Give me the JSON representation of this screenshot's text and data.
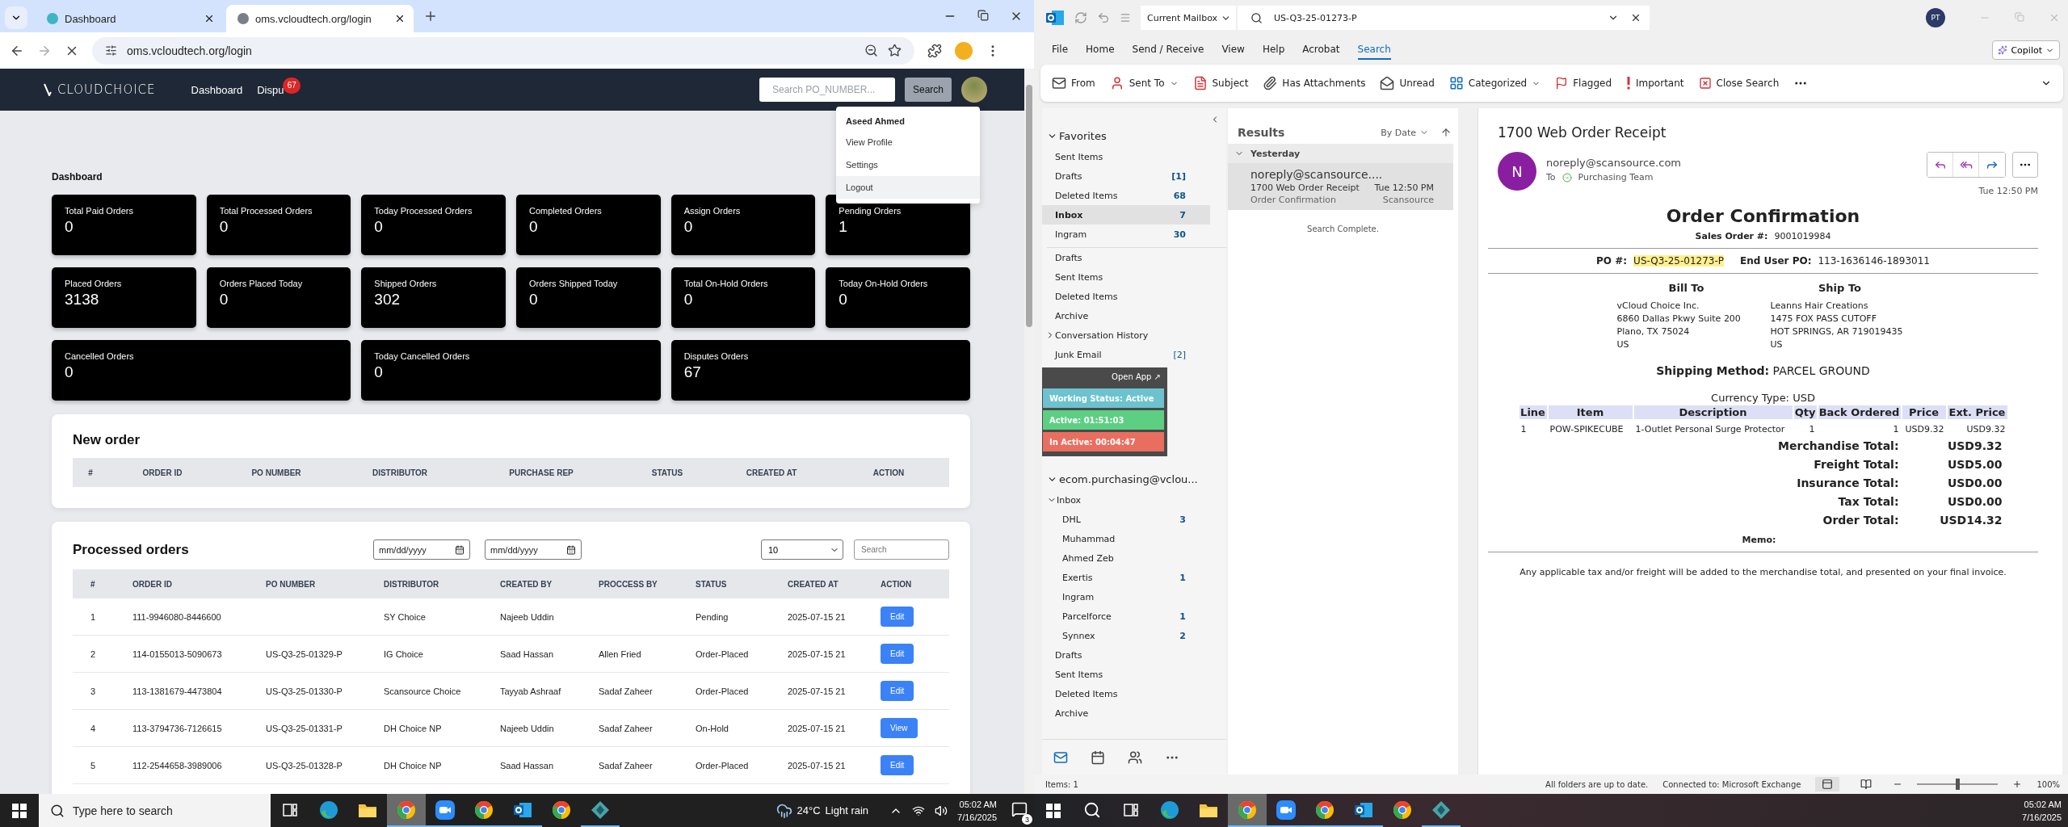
{
  "browser": {
    "tabs": [
      {
        "title": "Dashboard",
        "selected": false
      },
      {
        "title": "oms.vcloudtech.org/login",
        "selected": true
      }
    ],
    "address": "oms.vcloudtech.org/login",
    "nav": {
      "logo": "CLOUDCHOICE",
      "links": [
        {
          "label": "Dashboard"
        },
        {
          "label": "Dispu",
          "badge": "67"
        }
      ],
      "search_placeholder": "Search PO_NUMBER...",
      "search_button": "Search"
    },
    "user_menu": {
      "name": "Aseed Ahmed",
      "items": [
        {
          "label": "View Profile",
          "hovered": false
        },
        {
          "label": "Settings",
          "hovered": false
        },
        {
          "label": "Logout",
          "hovered": true
        }
      ]
    },
    "dashboard": {
      "title": "Dashboard",
      "cards": [
        {
          "label": "Total Paid Orders",
          "value": "0",
          "kind": "normal"
        },
        {
          "label": "Total Processed Orders",
          "value": "0",
          "kind": "normal"
        },
        {
          "label": "Today Processed Orders",
          "value": "0",
          "kind": "normal"
        },
        {
          "label": "Completed Orders",
          "value": "0",
          "kind": "normal"
        },
        {
          "label": "Assign Orders",
          "value": "0",
          "kind": "normal"
        },
        {
          "label": "Pending Orders",
          "value": "1",
          "kind": "normal"
        },
        {
          "label": "Placed Orders",
          "value": "3138",
          "kind": "normal"
        },
        {
          "label": "Orders Placed Today",
          "value": "0",
          "kind": "normal"
        },
        {
          "label": "Shipped Orders",
          "value": "302",
          "kind": "normal"
        },
        {
          "label": "Orders Shipped Today",
          "value": "0",
          "kind": "normal"
        },
        {
          "label": "Total On-Hold Orders",
          "value": "0",
          "kind": "normal"
        },
        {
          "label": "Today On-Hold Orders",
          "value": "0",
          "kind": "normal"
        },
        {
          "label": "Cancelled Orders",
          "value": "0",
          "kind": "wide"
        },
        {
          "label": "Today Cancelled Orders",
          "value": "0",
          "kind": "wide"
        },
        {
          "label": "Disputes Orders",
          "value": "67",
          "kind": "wide"
        }
      ]
    },
    "new_order": {
      "title": "New order",
      "columns": [
        "#",
        "ORDER ID",
        "PO NUMBER",
        "DISTRIBUTOR",
        "PURCHASE REP",
        "STATUS",
        "CREATED AT",
        "ACTION"
      ]
    },
    "processed": {
      "title": "Processed orders",
      "date_from": "mm/dd/yyyy",
      "date_to": "mm/dd/yyyy",
      "page_size": "10",
      "search_placeholder": "Search",
      "columns": [
        "#",
        "ORDER ID",
        "PO NUMBER",
        "DISTRIBUTOR",
        "CREATED BY",
        "PROCCESS BY",
        "STATUS",
        "CREATED AT",
        "ACTION"
      ],
      "rows": [
        {
          "num": "1",
          "order_id": "111-9946080-8446600",
          "distributor": "SY Choice",
          "created_by": "Najeeb Uddin",
          "status": "Pending",
          "created_at": "2025-07-15 21",
          "action": "Edit"
        },
        {
          "num": "2",
          "order_id": "114-0155013-5090673",
          "po_number": "US-Q3-25-01329-P",
          "distributor": "IG Choice",
          "created_by": "Saad Hassan",
          "process_by": "Allen Fried",
          "status": "Order-Placed",
          "created_at": "2025-07-15 21",
          "action": "Edit"
        },
        {
          "num": "3",
          "order_id": "113-1381679-4473804",
          "po_number": "US-Q3-25-01330-P",
          "distributor": "Scansource Choice",
          "created_by": "Tayyab Ashraaf",
          "process_by": "Sadaf Zaheer",
          "status": "Order-Placed",
          "created_at": "2025-07-15 21",
          "action": "Edit"
        },
        {
          "num": "4",
          "order_id": "113-3794736-7126615",
          "po_number": "US-Q3-25-01331-P",
          "distributor": "DH Choice NP",
          "created_by": "Najeeb Uddin",
          "process_by": "Sadaf Zaheer",
          "status": "On-Hold",
          "created_at": "2025-07-15 21",
          "action": "View"
        },
        {
          "num": "5",
          "order_id": "112-2544658-3989006",
          "po_number": "US-Q3-25-01328-P",
          "distributor": "DH Choice NP",
          "created_by": "Saad Hassan",
          "process_by": "Sadaf Zaheer",
          "status": "Order-Placed",
          "created_at": "2025-07-15 21",
          "action": "Edit"
        }
      ]
    }
  },
  "taskbar_left": {
    "search_placeholder": "Type here to search",
    "apps": [
      {
        "kind": "task-view",
        "selected": false,
        "running": false
      },
      {
        "kind": "edge",
        "selected": false,
        "running": false
      },
      {
        "kind": "explorer",
        "selected": false,
        "running": false
      },
      {
        "kind": "chrome",
        "selected": true,
        "running": true
      },
      {
        "kind": "zoom",
        "selected": false,
        "running": true
      },
      {
        "kind": "chrome",
        "selected": false,
        "running": true
      },
      {
        "kind": "outlook",
        "selected": false,
        "running": true
      },
      {
        "kind": "chrome",
        "selected": false,
        "running": false
      },
      {
        "kind": "app",
        "selected": false,
        "running": true
      }
    ],
    "weather": {
      "temp": "24°C",
      "text": "Light rain"
    },
    "time": "05:02 AM",
    "date": "7/16/2025",
    "notifications": "3"
  },
  "outlook": {
    "mailbox_scope": "Current Mailbox",
    "search_query": "US-Q3-25-01273-P",
    "user_initials": "PT",
    "copilot": "Copilot",
    "menu": [
      {
        "label": "File",
        "selected": false
      },
      {
        "label": "Home",
        "selected": false
      },
      {
        "label": "Send / Receive",
        "selected": false
      },
      {
        "label": "View",
        "selected": false
      },
      {
        "label": "Help",
        "selected": false
      },
      {
        "label": "Acrobat",
        "selected": false
      },
      {
        "label": "Search",
        "selected": true
      }
    ],
    "ribbon": [
      {
        "label": "From",
        "kind": "from",
        "dropdown": false
      },
      {
        "label": "Sent To",
        "kind": "sent-to",
        "dropdown": true
      },
      {
        "label": "Subject",
        "kind": "subject",
        "dropdown": false
      },
      {
        "label": "Has Attachments",
        "kind": "attachments",
        "dropdown": false
      },
      {
        "label": "Unread",
        "kind": "unread",
        "dropdown": false
      },
      {
        "label": "Categorized",
        "kind": "categorized",
        "dropdown": true
      },
      {
        "label": "Flagged",
        "kind": "flagged",
        "dropdown": false
      },
      {
        "label": "Important",
        "kind": "important",
        "dropdown": false
      },
      {
        "label": "Close Search",
        "kind": "close-search",
        "dropdown": false
      }
    ],
    "favorites": {
      "label": "Favorites",
      "expanded": true,
      "items": [
        {
          "name": "Sent Items",
          "selected": false
        },
        {
          "name": "Drafts",
          "count": "[1]",
          "selected": false
        },
        {
          "name": "Deleted Items",
          "count": "68",
          "selected": false
        },
        {
          "name": "Inbox",
          "count": "7",
          "selected": true
        },
        {
          "name": "Ingram",
          "count": "30",
          "selected": false
        }
      ]
    },
    "folders": [
      {
        "name": "Drafts"
      },
      {
        "name": "Sent Items"
      },
      {
        "name": "Deleted Items"
      },
      {
        "name": "Archive"
      },
      {
        "name": "Conversation History",
        "expanded": false
      },
      {
        "name": "Junk Email",
        "count": "[2]"
      }
    ],
    "status_widget": {
      "open_app": "Open App ↗",
      "rows": [
        {
          "label": "Working Status: Active",
          "color": "#6cc3cf"
        },
        {
          "label": "Active: 01:51:03",
          "color": "#5ccf83"
        },
        {
          "label": "In Active: 00:04:47",
          "color": "#ea6e5f"
        }
      ]
    },
    "account": {
      "label": "ecom.purchasing@vclou...",
      "expanded": true,
      "folders": [
        {
          "name": "Inbox",
          "expanded": true,
          "children": [
            {
              "name": "DHL",
              "count": "3"
            },
            {
              "name": "Muhammad"
            },
            {
              "name": "Ahmed Zeb"
            },
            {
              "name": "Exertis",
              "count": "1"
            },
            {
              "name": "Ingram"
            },
            {
              "name": "Parcelforce",
              "count": "1"
            },
            {
              "name": "Synnex",
              "count": "2"
            }
          ]
        },
        {
          "name": "Drafts"
        },
        {
          "name": "Sent Items"
        },
        {
          "name": "Deleted Items"
        },
        {
          "name": "Archive"
        }
      ]
    },
    "results": {
      "title": "Results",
      "sort": "By Date",
      "group": "Yesterday",
      "items": [
        {
          "sender": "noreply@scansource....",
          "subject": "1700 Web Order Receipt",
          "time": "Tue 12:50 PM",
          "preview": "Order Confirmation",
          "folder": "Scansource",
          "selected": true
        }
      ],
      "status": "Search Complete."
    },
    "reading": {
      "subject": "1700 Web Order Receipt",
      "avatar_initial": "N",
      "sender": "noreply@scansource.com",
      "to_label": "To",
      "recipient": "Purchasing Team",
      "time": "Tue 12:50 PM",
      "email": {
        "heading": "Order Confirmation",
        "sales_order_label": "Sales Order #:",
        "sales_order": "9001019984",
        "po_label": "PO #:",
        "po": "US-Q3-25-01273-P",
        "end_user_label": "End User PO:",
        "end_user_po": "113-1636146-1893011",
        "addresses": [
          {
            "title": "Bill To",
            "lines": [
              "vCloud Choice Inc.",
              "6860 Dallas Pkwy Suite 200",
              "Plano, TX 75024",
              "US"
            ]
          },
          {
            "title": "Ship To",
            "lines": [
              "Leanns Hair Creations",
              "1475 FOX PASS CUTOFF",
              "HOT SPRINGS, AR 719019435",
              "US"
            ]
          }
        ],
        "shipping": "**Shipping Method:** PARCEL GROUND",
        "currency": "Currency Type: USD",
        "line_columns": [
          "Line",
          "Item",
          "Description",
          "Qty",
          "Back Ordered",
          "Price",
          "Ext. Price"
        ],
        "lines": [
          [
            "1",
            "POW-SPIKECUBE",
            "1-Outlet Personal Surge Protector",
            "1",
            "1",
            "USD9.32",
            "USD9.32"
          ]
        ],
        "totals": [
          {
            "label": "Merchandise Total:",
            "value": "USD9.32"
          },
          {
            "label": "Freight Total:",
            "value": "USD5.00"
          },
          {
            "label": "Insurance Total:",
            "value": "USD0.00"
          },
          {
            "label": "Tax Total:",
            "value": "USD0.00"
          },
          {
            "label": "Order Total:",
            "value": "USD14.32"
          }
        ],
        "memo": "Memo:",
        "footer": "Any applicable tax and/or freight will be added to the merchandise total, and presented on your final invoice."
      }
    },
    "status_bar": {
      "items": "Items: 1",
      "sync": "All folders are up to date.",
      "connection": "Connected to: Microsoft Exchange",
      "zoom": "100%",
      "level": 0.5
    }
  },
  "taskbar_right": {
    "apps": [
      {
        "kind": "search",
        "selected": false,
        "running": false
      },
      {
        "kind": "task-view",
        "selected": false,
        "running": false
      },
      {
        "kind": "edge",
        "selected": false,
        "running": false
      },
      {
        "kind": "explorer",
        "selected": false,
        "running": false
      },
      {
        "kind": "chrome",
        "selected": true,
        "running": true
      },
      {
        "kind": "zoom",
        "selected": false,
        "running": true
      },
      {
        "kind": "chrome",
        "selected": false,
        "running": true
      },
      {
        "kind": "outlook",
        "selected": false,
        "running": true
      },
      {
        "kind": "chrome",
        "selected": false,
        "running": false
      },
      {
        "kind": "app",
        "selected": false,
        "running": true
      }
    ],
    "time": "05:02 AM",
    "date": "7/16/2025"
  }
}
